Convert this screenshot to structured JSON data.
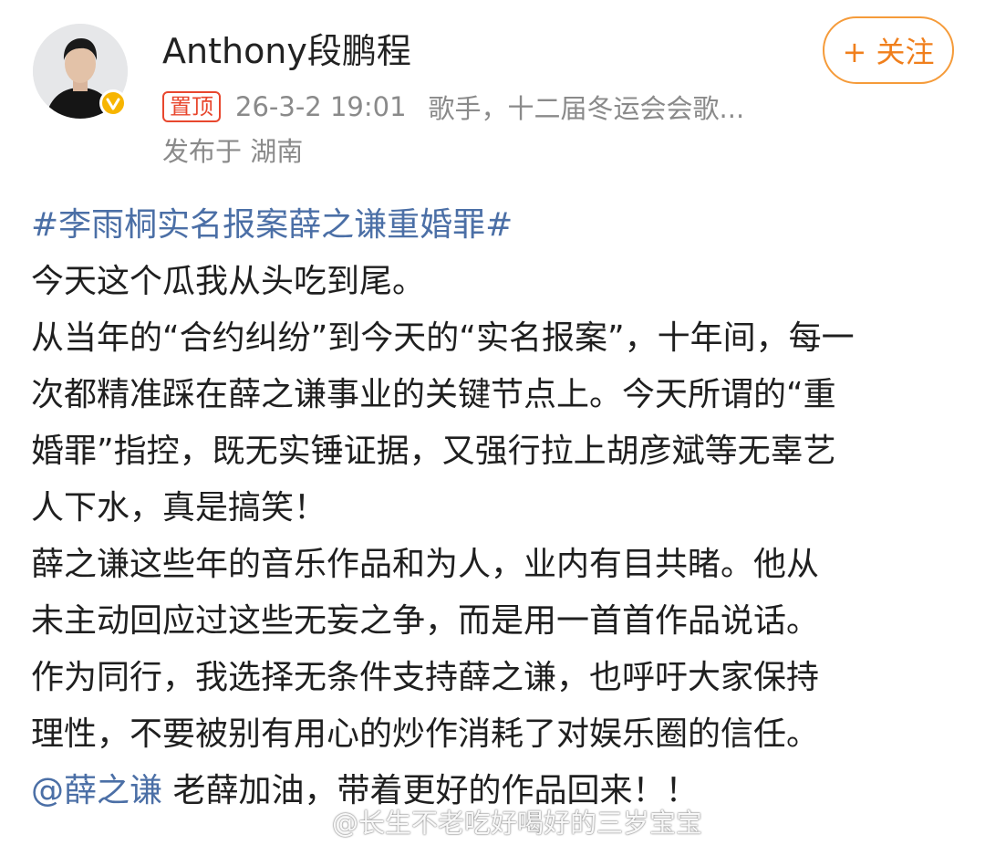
{
  "post": {
    "author_name": "Anthony段鹏程",
    "pin_badge": "置顶",
    "timestamp": "26-3-2 19:01",
    "author_desc": "歌手，十二届冬运会会歌...",
    "location": "发布于 湖南",
    "follow_label": "+ 关注",
    "hashtag": "#李雨桐实名报案薛之谦重婚罪#",
    "lines": [
      "今天这个瓜我从头吃到尾。",
      "从当年的“合约纠纷”到今天的“实名报案”，十年间，每一",
      "次都精准踩在薛之谦事业的关键节点上。今天所谓的“重",
      "婚罪”指控，既无实锤证据，又强行拉上胡彦斌等无辜艺",
      "人下水，真是搞笑！",
      "薛之谦这些年的音乐作品和为人，业内有目共睹。他从",
      "未主动回应过这些无妄之争，而是用一首首作品说话。",
      "作为同行，我选择无条件支持薛之谦，也呼吁大家保持",
      "理性，不要被别有用心的炒作消耗了对娱乐圈的信任。"
    ],
    "mention": "@薛之谦",
    "mention_tail": " 老薛加油，带着更好的作品回来！！",
    "watermark": "@长生不老吃好喝好的三岁宝宝"
  },
  "icons": {
    "avatar": "avatar-photo",
    "verified": "verified-badge-icon",
    "watermark_logo": "weibo-logo-icon"
  },
  "colors": {
    "link": "#4b6fa6",
    "follow": "#f07f1c",
    "pin": "#e8472e",
    "verified": "#f7b500",
    "meta": "#8a8a8a"
  }
}
